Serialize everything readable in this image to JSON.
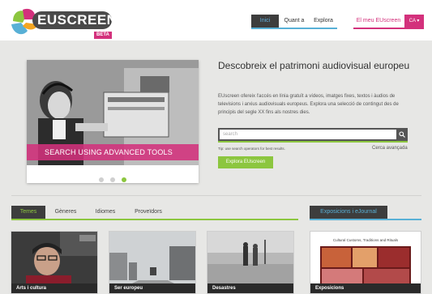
{
  "brand": {
    "name": "EUSCREEN",
    "beta": "BETA",
    "colors": {
      "pink": "#d3317c",
      "blue": "#58b0d6",
      "green": "#8cc63f",
      "dark": "#3d3d3d"
    }
  },
  "nav": {
    "items": [
      {
        "label": "Inici",
        "active": true
      },
      {
        "label": "Quant a"
      },
      {
        "label": "Explora"
      }
    ],
    "my_euscreen": "El meu EUscreen",
    "lang": "CA ▾"
  },
  "hero": {
    "slide_banner": "SEARCH USING ADVANCED TOOLS",
    "slides_total": 3,
    "active_slide": 3,
    "title": "Descobreix el patrimoni audiovisual europeu",
    "description": "EUscreen ofereix l'accés en línia gratuït a vídeos, imatges fixes, textos i àudios de televisions i arxius audiovisuals europeus. Explora una selecció de contingut des de principis del segle XX fins als nostres dies.",
    "search_placeholder": "search",
    "search_icon": "search-icon",
    "tip": "Tip: use search operators for best results.",
    "advanced_search": "Cerca avançada",
    "explore_button": "Explora EUscreen"
  },
  "browse": {
    "tabs": [
      {
        "label": "Temes",
        "active": true
      },
      {
        "label": "Gèneres"
      },
      {
        "label": "Idiomes"
      },
      {
        "label": "Proveïdors"
      }
    ],
    "right_tab": "Exposicions i eJournal",
    "thumbnails": [
      {
        "label": "Arts i cultura"
      },
      {
        "label": "Ser europeu"
      },
      {
        "label": "Desastres"
      }
    ],
    "exhibition": {
      "title": "Cultural Customs, Traditions and Rituals",
      "label": "Exposicions"
    }
  }
}
